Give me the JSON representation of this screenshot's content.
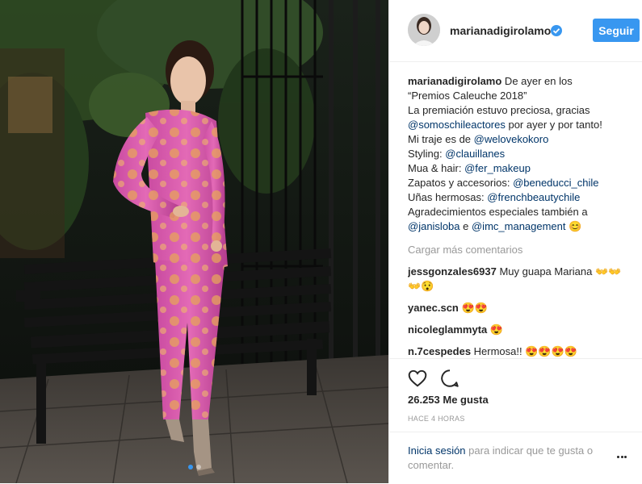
{
  "post": {
    "username": "marianadigirolamo",
    "follow_label": "Seguir",
    "caption_lines": [
      [
        {
          "t": "marianadigirolamo",
          "k": "user"
        },
        {
          "t": " De ayer en los",
          "k": "text"
        }
      ],
      [
        {
          "t": "“Premios Caleuche 2018”",
          "k": "text"
        }
      ],
      [
        {
          "t": "La premiación estuvo preciosa, gracias",
          "k": "text"
        }
      ],
      [
        {
          "t": "@somoschileactores",
          "k": "mention"
        },
        {
          "t": " por ayer y por tanto!",
          "k": "text"
        }
      ],
      [
        {
          "t": "Mi traje es de ",
          "k": "text"
        },
        {
          "t": "@welovekokoro",
          "k": "mention"
        }
      ],
      [
        {
          "t": "Styling: ",
          "k": "text"
        },
        {
          "t": "@clauillanes",
          "k": "mention"
        }
      ],
      [
        {
          "t": "Mua & hair: ",
          "k": "text"
        },
        {
          "t": "@fer_makeup",
          "k": "mention"
        }
      ],
      [
        {
          "t": "Zapatos y accesorios: ",
          "k": "text"
        },
        {
          "t": "@beneducci_chile",
          "k": "mention"
        }
      ],
      [
        {
          "t": "Uñas hermosas: ",
          "k": "text"
        },
        {
          "t": "@frenchbeautychile",
          "k": "mention"
        }
      ],
      [
        {
          "t": "Agradecimientos especiales también a",
          "k": "text"
        }
      ],
      [
        {
          "t": "@janisloba",
          "k": "mention"
        },
        {
          "t": " e ",
          "k": "text"
        },
        {
          "t": "@imc_management",
          "k": "mention"
        },
        {
          "t": " 😊",
          "k": "text"
        }
      ]
    ],
    "load_more": "Cargar más comentarios",
    "comments": [
      {
        "lines": [
          [
            {
              "t": "jessgonzales6937",
              "k": "user"
            },
            {
              "t": " Muy guapa Mariana 👐👐",
              "k": "text"
            }
          ],
          [
            {
              "t": "👐😯",
              "k": "text"
            }
          ]
        ]
      },
      {
        "lines": [
          [
            {
              "t": "yanec.scn",
              "k": "user"
            },
            {
              "t": " 😍😍",
              "k": "text"
            }
          ]
        ]
      },
      {
        "lines": [
          [
            {
              "t": "nicoleglammyta",
              "k": "user"
            },
            {
              "t": " 😍",
              "k": "text"
            }
          ]
        ]
      },
      {
        "lines": [
          [
            {
              "t": "n.7cespedes",
              "k": "user"
            },
            {
              "t": " Hermosa!! 😍😍😍😍",
              "k": "text"
            }
          ]
        ]
      }
    ],
    "likes": "26.253 Me gusta",
    "time": "HACE 4 HORAS",
    "login": {
      "link": "Inicia sesión",
      "rest": " para indicar que te gusta o comentar."
    },
    "icons": {
      "like": "heart-icon",
      "comment": "comment-bubble-icon",
      "verified": "verified-badge-icon",
      "options": "more-options-icon"
    },
    "colors": {
      "accent": "#3897f0",
      "mention": "#003569",
      "muted": "#999999"
    },
    "carousel": {
      "count": 2,
      "active": 0
    }
  }
}
